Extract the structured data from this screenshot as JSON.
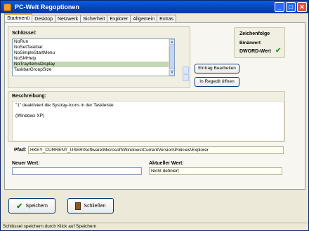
{
  "window": {
    "title": "PC-Welt Regoptionen"
  },
  "titlebar_buttons": {
    "minimize": "_",
    "maximize": "□",
    "close": "✕"
  },
  "tabs": [
    {
      "label": "Startmenü"
    },
    {
      "label": "Desktop"
    },
    {
      "label": "Netzwerk"
    },
    {
      "label": "Sicherheit"
    },
    {
      "label": "Explorer"
    },
    {
      "label": "Allgemein"
    },
    {
      "label": "Extras"
    }
  ],
  "keys": {
    "label": "Schlüssel:",
    "items": [
      {
        "label": "NoRun"
      },
      {
        "label": "NoSetTaskbar"
      },
      {
        "label": "NoSimpleStartMenu"
      },
      {
        "label": "NoSMHelp"
      },
      {
        "label": "NoTrayItemsDisplay"
      },
      {
        "label": "TaskbarGroupSize"
      }
    ]
  },
  "actions": {
    "edit_entry": "Eintrag Bearbeiten",
    "open_regedit": "In Regedit öffnen"
  },
  "sequence": {
    "title": "Zeichenfolge",
    "binary": "Binärwert",
    "dword": "DWORD-Wert",
    "dword_check": "✔"
  },
  "description": {
    "label": "Beschreibung:",
    "line1": "\"1\" deaktiviert die Systray-Icons in der Taskleiste",
    "line2": "(Windows XP)"
  },
  "path": {
    "label": "Pfad:",
    "value": "HKEY_CURRENT_USER\\Software\\Microsoft\\Windows\\CurrentVersion\\Policies\\Explorer"
  },
  "new_value": {
    "label": "Neuer Wert:",
    "value": ""
  },
  "current_value": {
    "label": "Aktueller Wert:",
    "value": "Nicht definiert"
  },
  "buttons": {
    "save": "Speichern",
    "close": "Schließen"
  },
  "status": {
    "text": "Schlüssel speichern durch Klick auf Speichern"
  }
}
